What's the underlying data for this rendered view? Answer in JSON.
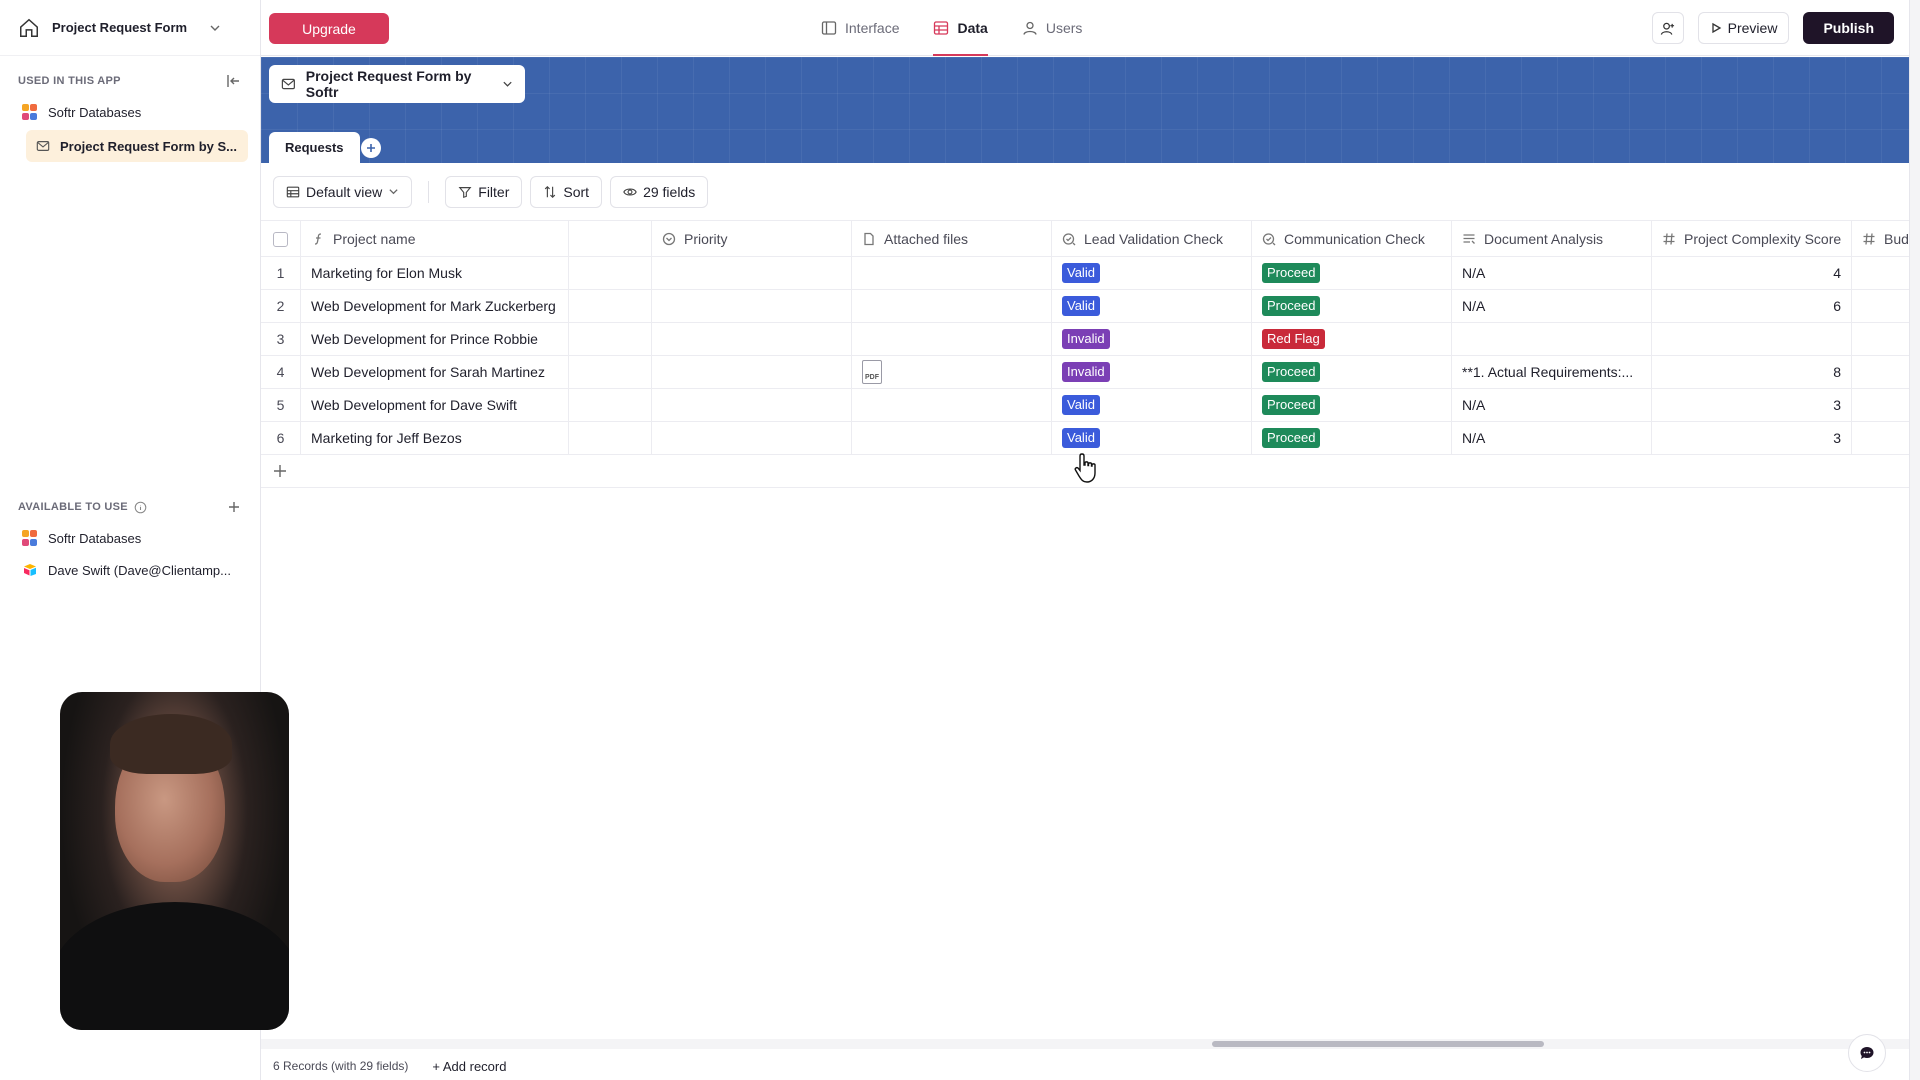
{
  "app": {
    "name": "Project Request Form"
  },
  "topbar": {
    "upgrade_label": "Upgrade",
    "tabs": [
      {
        "label": "Interface",
        "icon": "layout-icon"
      },
      {
        "label": "Data",
        "icon": "table-icon",
        "active": true
      },
      {
        "label": "Users",
        "icon": "user-icon"
      }
    ],
    "preview_label": "Preview",
    "publish_label": "Publish"
  },
  "sidebar": {
    "used_heading": "USED IN THIS APP",
    "used_items": [
      {
        "label": "Softr Databases"
      },
      {
        "label": "Project Request Form by S..."
      }
    ],
    "available_heading": "AVAILABLE TO USE",
    "available_items": [
      {
        "label": "Softr Databases"
      },
      {
        "label": "Dave Swift (Dave@Clientamp..."
      }
    ]
  },
  "banner": {
    "table_name": "Project Request Form by Softr",
    "tab_label": "Requests"
  },
  "toolbar": {
    "view_label": "Default view",
    "filter_label": "Filter",
    "sort_label": "Sort",
    "fields_label": "29 fields"
  },
  "columns": [
    {
      "label": "Project name",
      "icon": "formula-icon"
    },
    {
      "label": "",
      "icon": ""
    },
    {
      "label": "Priority",
      "icon": "select-icon"
    },
    {
      "label": "Attached files",
      "icon": "file-icon"
    },
    {
      "label": "Lead Validation Check",
      "icon": "ai-check-icon"
    },
    {
      "label": "Communication Check",
      "icon": "ai-check-icon"
    },
    {
      "label": "Document Analysis",
      "icon": "long-text-icon"
    },
    {
      "label": "Project Complexity Score",
      "icon": "number-icon"
    },
    {
      "label": "Bud",
      "icon": "number-icon"
    }
  ],
  "rows": [
    {
      "num": "1",
      "name": "Marketing for Elon Musk",
      "pdf": false,
      "lead": "Valid",
      "comm": "Proceed",
      "doc": "N/A",
      "score": "4"
    },
    {
      "num": "2",
      "name": "Web Development for Mark Zuckerberg",
      "pdf": false,
      "lead": "Valid",
      "comm": "Proceed",
      "doc": "N/A",
      "score": "6"
    },
    {
      "num": "3",
      "name": "Web Development for Prince Robbie",
      "pdf": false,
      "lead": "Invalid",
      "comm": "Red Flag",
      "doc": "",
      "score": ""
    },
    {
      "num": "4",
      "name": "Web Development for Sarah Martinez",
      "pdf": true,
      "lead": "Invalid",
      "comm": "Proceed",
      "doc": "**1. Actual Requirements:...",
      "score": "8"
    },
    {
      "num": "5",
      "name": "Web Development for Dave Swift",
      "pdf": false,
      "lead": "Valid",
      "comm": "Proceed",
      "doc": "N/A",
      "score": "3"
    },
    {
      "num": "6",
      "name": "Marketing for Jeff Bezos",
      "pdf": false,
      "lead": "Valid",
      "comm": "Proceed",
      "doc": "N/A",
      "score": "3"
    }
  ],
  "pdf_label": "PDF",
  "badge_colors": {
    "Valid": "#3b5bdb",
    "Invalid": "#7b3fb5",
    "Proceed": "#1e8a5a",
    "Red Flag": "#c92a3a"
  },
  "footer": {
    "records_label": "6 Records (with 29 fields)",
    "add_record_label": "+ Add record"
  },
  "colors": {
    "accent": "#d6395a",
    "banner": "#3c63ab",
    "publish": "#1f1428"
  }
}
